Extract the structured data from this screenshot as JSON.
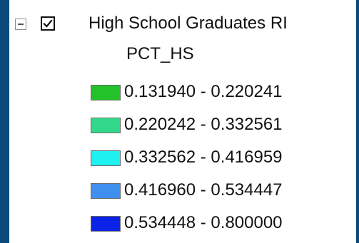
{
  "layer": {
    "name": "High School Graduates RI",
    "checked": true,
    "expanded": true,
    "field": "PCT_HS"
  },
  "legend": [
    {
      "label": "0.131940 - 0.220241",
      "color": "#22c22a"
    },
    {
      "label": "0.220242 - 0.332561",
      "color": "#33d98a"
    },
    {
      "label": "0.332562 - 0.416959",
      "color": "#1ff0f0"
    },
    {
      "label": "0.416960 - 0.534447",
      "color": "#3f8fef"
    },
    {
      "label": "0.534448 - 0.800000",
      "color": "#0a23e6"
    }
  ],
  "colors": {
    "frame": "#0b4a7c",
    "panel": "#ffffff"
  },
  "icons": {
    "expander": "collapse-minus-icon",
    "checkbox": "checkmark-icon"
  }
}
